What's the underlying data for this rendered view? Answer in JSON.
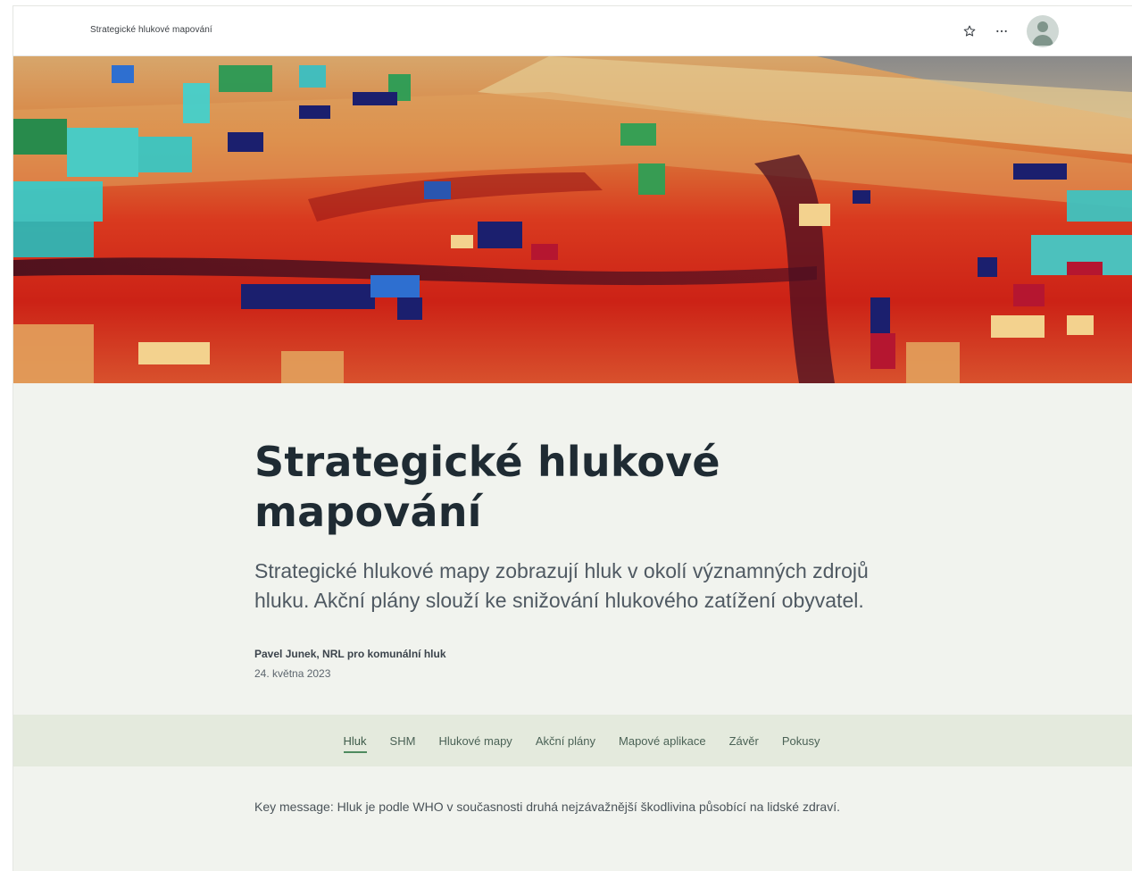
{
  "header": {
    "app_title": "Strategické hlukové mapování",
    "icons": [
      "star-icon",
      "more-icon",
      "user-icon"
    ]
  },
  "hero": {
    "image": "3D noise map of urban area with colored buildings"
  },
  "article": {
    "title": "Strategické hlukové mapování",
    "subtitle": "Strategické hlukové mapy zobrazují hluk v okolí významných zdrojů hluku. Akční plány slouží ke snižování hlukového zatížení obyvatel.",
    "author": "Pavel Junek, NRL pro komunální hluk",
    "date": "24. května 2023"
  },
  "nav": {
    "items": [
      {
        "label": "Hluk",
        "active": true
      },
      {
        "label": "SHM",
        "active": false
      },
      {
        "label": "Hlukové mapy",
        "active": false
      },
      {
        "label": "Akční plány",
        "active": false
      },
      {
        "label": "Mapové aplikace",
        "active": false
      },
      {
        "label": "Závěr",
        "active": false
      },
      {
        "label": "Pokusy",
        "active": false
      }
    ]
  },
  "body": {
    "key_message": "Key message: Hluk je podle WHO v současnosti druhá nejzávažnější škodlivina působící na lidské zdraví."
  },
  "colors": {
    "accent": "#4e8b5f",
    "nav_band": "#e4eadd",
    "page_bg": "#f1f3ee",
    "title": "#1f2b33"
  }
}
